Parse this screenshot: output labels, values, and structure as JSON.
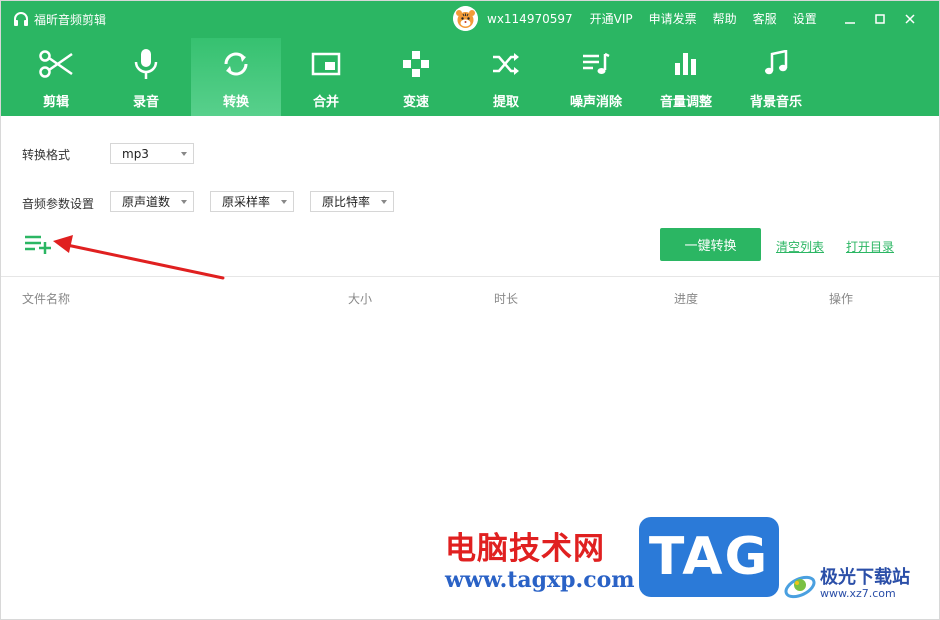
{
  "app": {
    "title": "福昕音频剪辑",
    "username": "wx114970597",
    "top_links": [
      "开通VIP",
      "申请发票",
      "帮助",
      "客服",
      "设置"
    ]
  },
  "toolbar": {
    "items": [
      {
        "label": "剪辑",
        "icon": "scissors-icon",
        "active": false
      },
      {
        "label": "录音",
        "icon": "microphone-icon",
        "active": false
      },
      {
        "label": "转换",
        "icon": "convert-icon",
        "active": true
      },
      {
        "label": "合并",
        "icon": "merge-icon",
        "active": false
      },
      {
        "label": "变速",
        "icon": "speed-icon",
        "active": false
      },
      {
        "label": "提取",
        "icon": "shuffle-icon",
        "active": false
      },
      {
        "label": "噪声消除",
        "icon": "noise-reduction-icon",
        "active": false
      },
      {
        "label": "音量调整",
        "icon": "volume-bars-icon",
        "active": false
      },
      {
        "label": "背景音乐",
        "icon": "music-note-icon",
        "active": false
      }
    ]
  },
  "settings": {
    "format_label": "转换格式",
    "format_value": "mp3",
    "params_label": "音频参数设置",
    "channels_value": "原声道数",
    "samplerate_value": "原采样率",
    "bitrate_value": "原比特率"
  },
  "actions": {
    "convert_label": "一键转换",
    "clear_label": "清空列表",
    "open_dir_label": "打开目录"
  },
  "table": {
    "headers": [
      "文件名称",
      "大小",
      "时长",
      "进度",
      "操作"
    ]
  },
  "watermark": {
    "cn": "电脑技术网",
    "url": "www.tagxp.com",
    "tag": "TAG",
    "jg_cn": "极光下载站",
    "jg_url": "www.xz7.com"
  },
  "colors": {
    "brand_green": "#2bb663",
    "annotation_arrow": "#e02020"
  }
}
